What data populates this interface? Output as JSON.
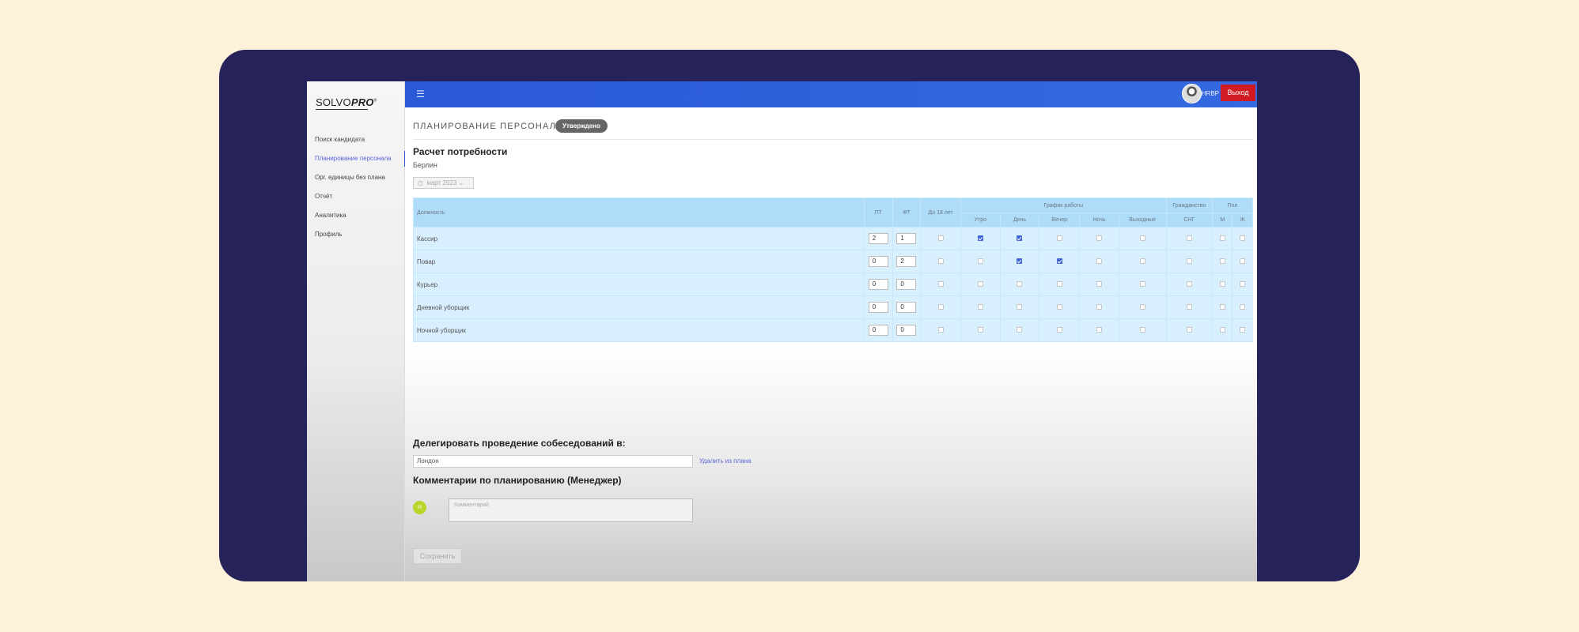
{
  "sidebar": {
    "logo_solvo": "SOLVO",
    "logo_pro": "PRO",
    "logo_mark": "®",
    "items": [
      {
        "label": "Поиск кандидата"
      },
      {
        "label": "Планирование персонала"
      },
      {
        "label": "Орг. единицы без плана"
      },
      {
        "label": "Отчёт"
      },
      {
        "label": "Аналитика"
      },
      {
        "label": "Профиль"
      }
    ],
    "active_index": 1
  },
  "header": {
    "menu_icon": "hamburger-icon",
    "user_name": "HRBP",
    "logout_label": "Выход"
  },
  "page": {
    "title": "ПЛАНИРОВАНИЕ ПЕРСОНАЛА",
    "status": "Утверждено",
    "calc_title": "Расчет потребности",
    "city": "Берлин",
    "month": "март 2023"
  },
  "table": {
    "col_position": "Должность",
    "col_pt": "ПТ",
    "col_ft": "ФТ",
    "col_under18": "До 18 лет",
    "group_schedule": "График работы",
    "group_citizenship": "Гражданство",
    "group_gender": "Пол",
    "sched_morning": "Утро",
    "sched_day": "День",
    "sched_evening": "Вечер",
    "sched_night": "Ночь",
    "sched_weekend": "Выходные",
    "cit_cis": "СНГ",
    "gender_m": "М",
    "gender_f": "Ж",
    "rows": [
      {
        "position": "Кассир",
        "pt": "2",
        "ft": "1",
        "checks": [
          false,
          true,
          true,
          false,
          false,
          false,
          false,
          false,
          false
        ]
      },
      {
        "position": "Повар",
        "pt": "0",
        "ft": "2",
        "checks": [
          false,
          false,
          true,
          true,
          false,
          false,
          false,
          false,
          false
        ]
      },
      {
        "position": "Курьер",
        "pt": "0",
        "ft": "0",
        "checks": [
          false,
          false,
          false,
          false,
          false,
          false,
          false,
          false,
          false
        ]
      },
      {
        "position": "Дневной уборщик",
        "pt": "0",
        "ft": "0",
        "checks": [
          false,
          false,
          false,
          false,
          false,
          false,
          false,
          false,
          false
        ]
      },
      {
        "position": "Ночной уборщик",
        "pt": "0",
        "ft": "0",
        "checks": [
          false,
          false,
          false,
          false,
          false,
          false,
          false,
          false,
          false
        ]
      }
    ]
  },
  "delegate": {
    "title": "Делегировать проведение собеседований в:",
    "value": "Лондон",
    "remove_label": "Удалить из плана"
  },
  "comments": {
    "title": "Комментарии по планированию (Менеджер)",
    "user_initial": "H",
    "placeholder": "Комментарий"
  },
  "save_label": "Сохранить",
  "colors": {
    "accent": "#3469e0",
    "logout": "#d11a22",
    "table_header": "#aedcf9",
    "table_row": "#d8effd"
  }
}
